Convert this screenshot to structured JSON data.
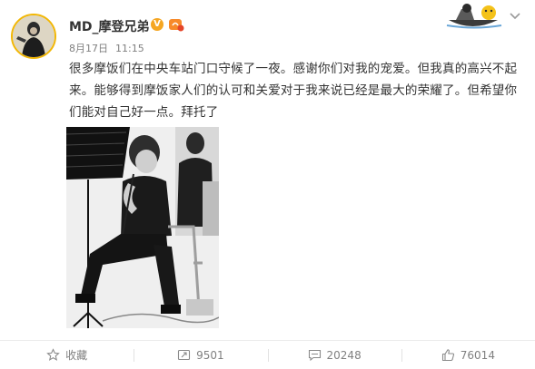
{
  "post": {
    "username": "MD_摩登兄弟",
    "verified_badge": "V",
    "date": "8月17日",
    "time": "11:15",
    "text": "很多摩饭们在中央车站门口守候了一夜。感谢你们对我的宠爱。但我真的高兴不起来。能够得到摩饭家人们的认可和关爱对于我来说已经是最大的荣耀了。但希望你们能对自己好一点。拜托了",
    "icons": {
      "avatar": "user-avatar",
      "badge": "verified-v-icon",
      "decoration": "boat-sticker-icon",
      "menu": "chevron-down-icon"
    }
  },
  "actions": {
    "favorite_label": "收藏",
    "repost_count": "9501",
    "comment_count": "20248",
    "like_count": "76014"
  },
  "colors": {
    "accent": "#f5a623",
    "meta_text": "#808080",
    "body_text": "#333333"
  }
}
